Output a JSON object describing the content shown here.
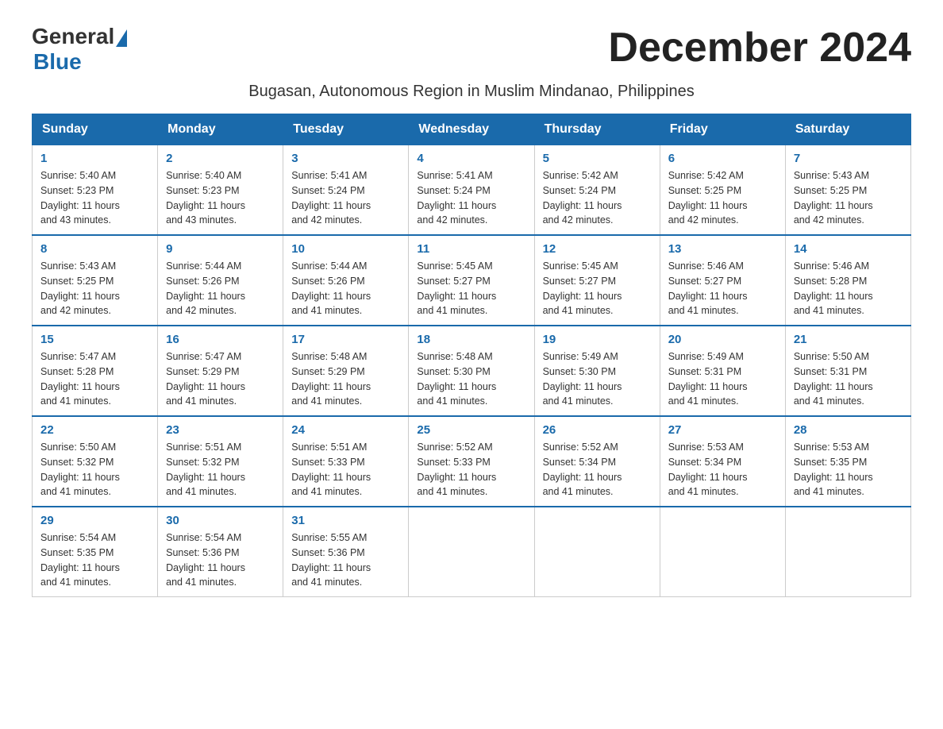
{
  "header": {
    "logo_general": "General",
    "logo_blue": "Blue",
    "month_title": "December 2024",
    "subtitle": "Bugasan, Autonomous Region in Muslim Mindanao, Philippines"
  },
  "days_of_week": [
    "Sunday",
    "Monday",
    "Tuesday",
    "Wednesday",
    "Thursday",
    "Friday",
    "Saturday"
  ],
  "weeks": [
    [
      {
        "day": "1",
        "sunrise": "5:40 AM",
        "sunset": "5:23 PM",
        "daylight": "11 hours and 43 minutes."
      },
      {
        "day": "2",
        "sunrise": "5:40 AM",
        "sunset": "5:23 PM",
        "daylight": "11 hours and 43 minutes."
      },
      {
        "day": "3",
        "sunrise": "5:41 AM",
        "sunset": "5:24 PM",
        "daylight": "11 hours and 42 minutes."
      },
      {
        "day": "4",
        "sunrise": "5:41 AM",
        "sunset": "5:24 PM",
        "daylight": "11 hours and 42 minutes."
      },
      {
        "day": "5",
        "sunrise": "5:42 AM",
        "sunset": "5:24 PM",
        "daylight": "11 hours and 42 minutes."
      },
      {
        "day": "6",
        "sunrise": "5:42 AM",
        "sunset": "5:25 PM",
        "daylight": "11 hours and 42 minutes."
      },
      {
        "day": "7",
        "sunrise": "5:43 AM",
        "sunset": "5:25 PM",
        "daylight": "11 hours and 42 minutes."
      }
    ],
    [
      {
        "day": "8",
        "sunrise": "5:43 AM",
        "sunset": "5:25 PM",
        "daylight": "11 hours and 42 minutes."
      },
      {
        "day": "9",
        "sunrise": "5:44 AM",
        "sunset": "5:26 PM",
        "daylight": "11 hours and 42 minutes."
      },
      {
        "day": "10",
        "sunrise": "5:44 AM",
        "sunset": "5:26 PM",
        "daylight": "11 hours and 41 minutes."
      },
      {
        "day": "11",
        "sunrise": "5:45 AM",
        "sunset": "5:27 PM",
        "daylight": "11 hours and 41 minutes."
      },
      {
        "day": "12",
        "sunrise": "5:45 AM",
        "sunset": "5:27 PM",
        "daylight": "11 hours and 41 minutes."
      },
      {
        "day": "13",
        "sunrise": "5:46 AM",
        "sunset": "5:27 PM",
        "daylight": "11 hours and 41 minutes."
      },
      {
        "day": "14",
        "sunrise": "5:46 AM",
        "sunset": "5:28 PM",
        "daylight": "11 hours and 41 minutes."
      }
    ],
    [
      {
        "day": "15",
        "sunrise": "5:47 AM",
        "sunset": "5:28 PM",
        "daylight": "11 hours and 41 minutes."
      },
      {
        "day": "16",
        "sunrise": "5:47 AM",
        "sunset": "5:29 PM",
        "daylight": "11 hours and 41 minutes."
      },
      {
        "day": "17",
        "sunrise": "5:48 AM",
        "sunset": "5:29 PM",
        "daylight": "11 hours and 41 minutes."
      },
      {
        "day": "18",
        "sunrise": "5:48 AM",
        "sunset": "5:30 PM",
        "daylight": "11 hours and 41 minutes."
      },
      {
        "day": "19",
        "sunrise": "5:49 AM",
        "sunset": "5:30 PM",
        "daylight": "11 hours and 41 minutes."
      },
      {
        "day": "20",
        "sunrise": "5:49 AM",
        "sunset": "5:31 PM",
        "daylight": "11 hours and 41 minutes."
      },
      {
        "day": "21",
        "sunrise": "5:50 AM",
        "sunset": "5:31 PM",
        "daylight": "11 hours and 41 minutes."
      }
    ],
    [
      {
        "day": "22",
        "sunrise": "5:50 AM",
        "sunset": "5:32 PM",
        "daylight": "11 hours and 41 minutes."
      },
      {
        "day": "23",
        "sunrise": "5:51 AM",
        "sunset": "5:32 PM",
        "daylight": "11 hours and 41 minutes."
      },
      {
        "day": "24",
        "sunrise": "5:51 AM",
        "sunset": "5:33 PM",
        "daylight": "11 hours and 41 minutes."
      },
      {
        "day": "25",
        "sunrise": "5:52 AM",
        "sunset": "5:33 PM",
        "daylight": "11 hours and 41 minutes."
      },
      {
        "day": "26",
        "sunrise": "5:52 AM",
        "sunset": "5:34 PM",
        "daylight": "11 hours and 41 minutes."
      },
      {
        "day": "27",
        "sunrise": "5:53 AM",
        "sunset": "5:34 PM",
        "daylight": "11 hours and 41 minutes."
      },
      {
        "day": "28",
        "sunrise": "5:53 AM",
        "sunset": "5:35 PM",
        "daylight": "11 hours and 41 minutes."
      }
    ],
    [
      {
        "day": "29",
        "sunrise": "5:54 AM",
        "sunset": "5:35 PM",
        "daylight": "11 hours and 41 minutes."
      },
      {
        "day": "30",
        "sunrise": "5:54 AM",
        "sunset": "5:36 PM",
        "daylight": "11 hours and 41 minutes."
      },
      {
        "day": "31",
        "sunrise": "5:55 AM",
        "sunset": "5:36 PM",
        "daylight": "11 hours and 41 minutes."
      },
      null,
      null,
      null,
      null
    ]
  ],
  "labels": {
    "sunrise": "Sunrise:",
    "sunset": "Sunset:",
    "daylight": "Daylight:"
  }
}
